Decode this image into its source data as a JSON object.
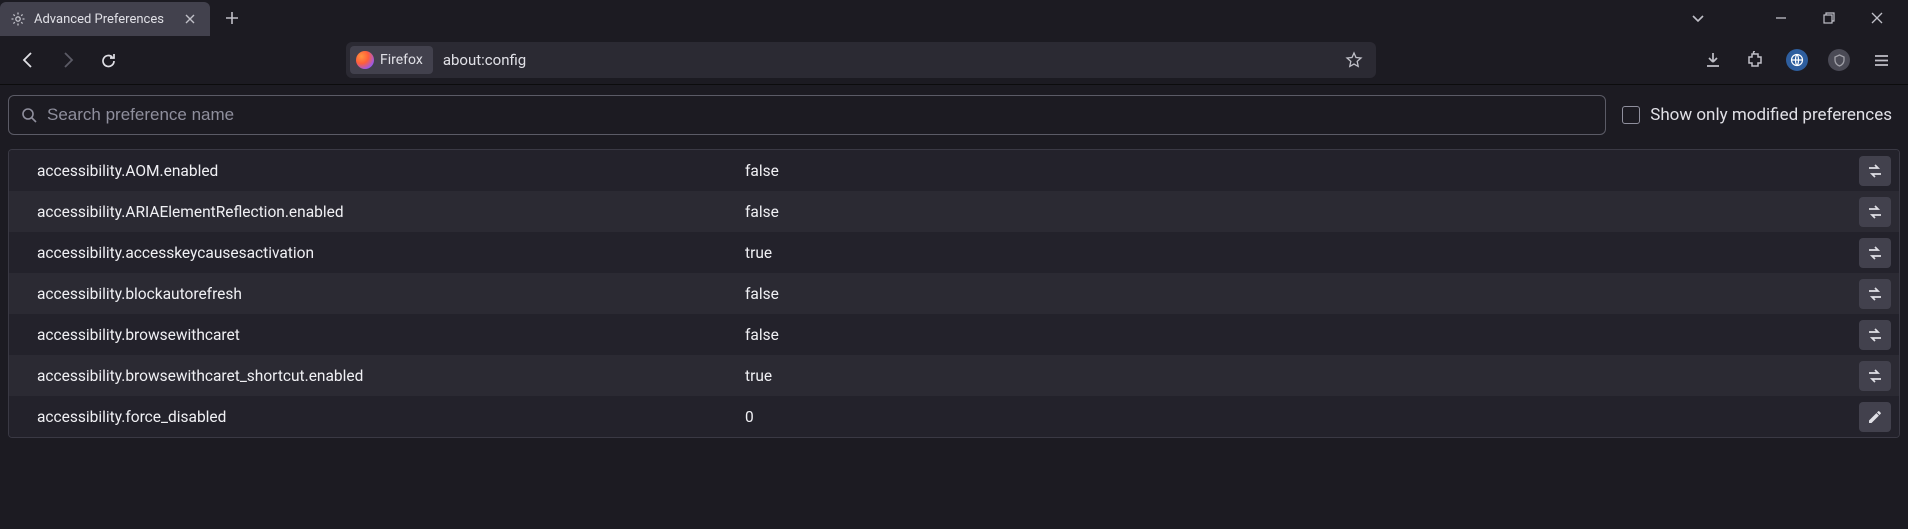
{
  "tab": {
    "title": "Advanced Preferences"
  },
  "urlbar": {
    "identity": "Firefox",
    "url": "about:config"
  },
  "search": {
    "placeholder": "Search preference name"
  },
  "filter": {
    "label": "Show only modified preferences"
  },
  "prefs": [
    {
      "name": "accessibility.AOM.enabled",
      "value": "false",
      "action": "toggle"
    },
    {
      "name": "accessibility.ARIAElementReflection.enabled",
      "value": "false",
      "action": "toggle"
    },
    {
      "name": "accessibility.accesskeycausesactivation",
      "value": "true",
      "action": "toggle"
    },
    {
      "name": "accessibility.blockautorefresh",
      "value": "false",
      "action": "toggle"
    },
    {
      "name": "accessibility.browsewithcaret",
      "value": "false",
      "action": "toggle"
    },
    {
      "name": "accessibility.browsewithcaret_shortcut.enabled",
      "value": "true",
      "action": "toggle"
    },
    {
      "name": "accessibility.force_disabled",
      "value": "0",
      "action": "edit"
    }
  ]
}
